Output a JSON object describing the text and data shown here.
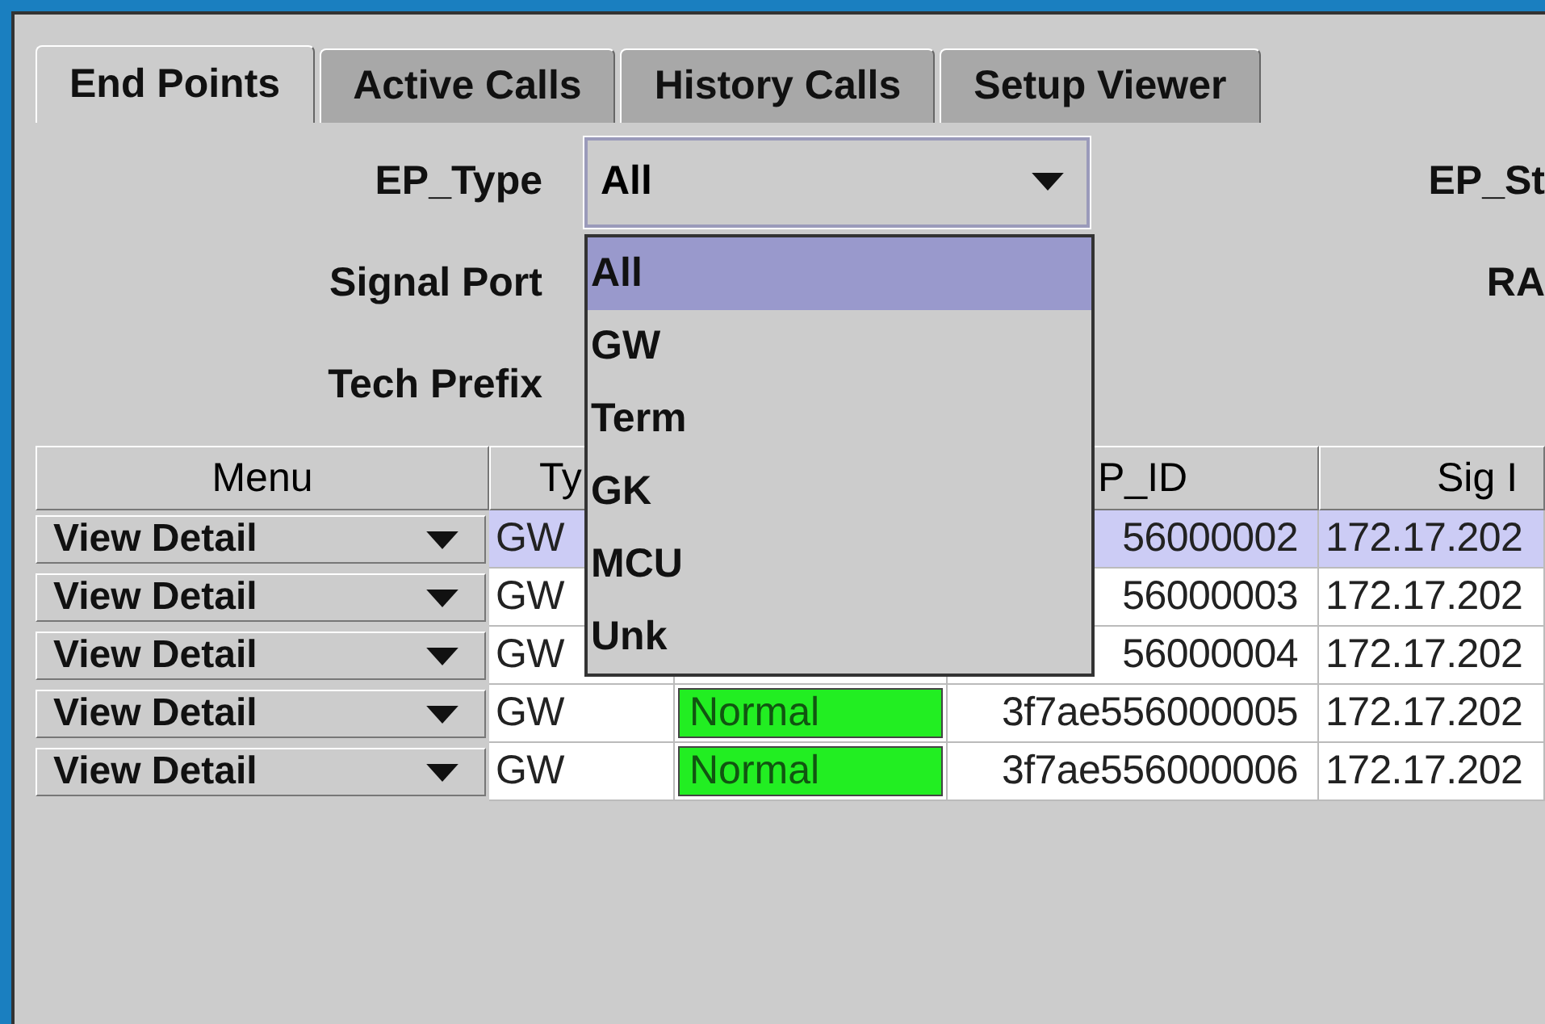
{
  "tabs": [
    {
      "label": "End Points",
      "selected": true
    },
    {
      "label": "Active Calls",
      "selected": false
    },
    {
      "label": "History Calls",
      "selected": false
    },
    {
      "label": "Setup Viewer",
      "selected": false
    }
  ],
  "filters": [
    {
      "label": "EP_Type",
      "value": "All",
      "right_label": "EP_St"
    },
    {
      "label": "Signal Port",
      "right_label": "RA"
    },
    {
      "label": "Tech Prefix"
    }
  ],
  "dropdown_list": [
    {
      "label": "All",
      "selected": true
    },
    {
      "label": "GW",
      "selected": false
    },
    {
      "label": "Term",
      "selected": false
    },
    {
      "label": "GK",
      "selected": false
    },
    {
      "label": "MCU",
      "selected": false
    },
    {
      "label": "Unk",
      "selected": false
    }
  ],
  "table": {
    "columns": [
      "Menu",
      "Ty",
      "",
      "P_ID",
      "Sig I"
    ],
    "rows": [
      {
        "menu": "View Detail",
        "type": "GW",
        "ep_id": "56000002",
        "sig_ip": "172.17.202",
        "selected": true
      },
      {
        "menu": "View Detail",
        "type": "GW",
        "ep_id": "56000003",
        "sig_ip": "172.17.202",
        "selected": false
      },
      {
        "menu": "View Detail",
        "type": "GW",
        "ep_id": "56000004",
        "sig_ip": "172.17.202",
        "selected": false
      },
      {
        "menu": "View Detail",
        "type": "GW",
        "status": "Normal",
        "ep_id": "3f7ae556000005",
        "sig_ip": "172.17.202",
        "selected": false
      },
      {
        "menu": "View Detail",
        "type": "GW",
        "status": "Normal",
        "ep_id": "3f7ae556000006",
        "sig_ip": "172.17.202",
        "selected": false
      }
    ]
  }
}
